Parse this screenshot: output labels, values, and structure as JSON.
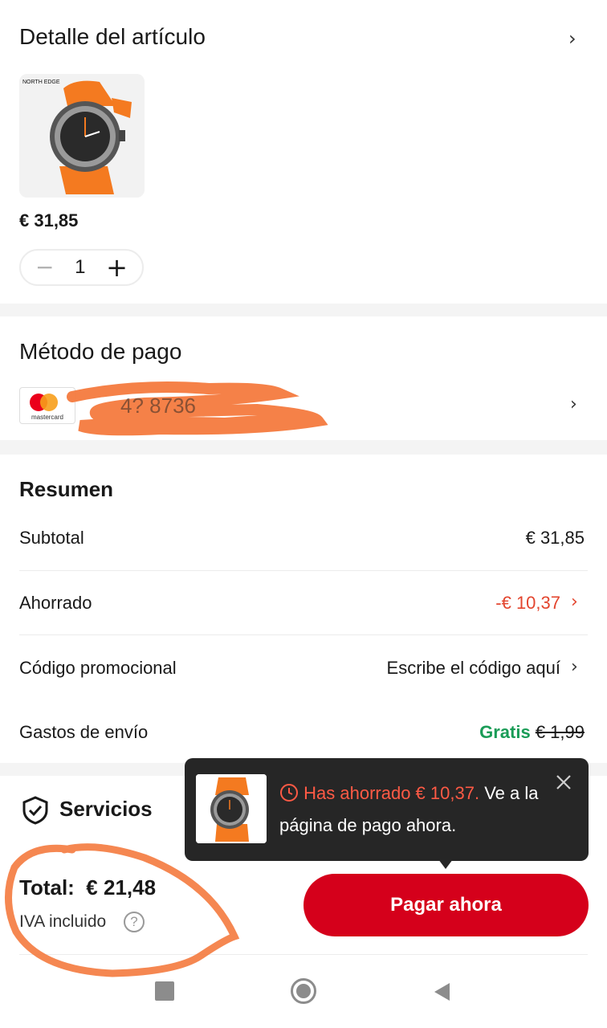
{
  "item_detail": {
    "title": "Detalle del artículo",
    "brand_text": "NORTH EDGE",
    "price": "€ 31,85",
    "quantity": "1",
    "minus_symbol": "−",
    "plus_symbol": "+"
  },
  "payment": {
    "title": "Método de pago",
    "card_brand": "mastercard"
  },
  "summary": {
    "title": "Resumen",
    "rows": [
      {
        "label": "Subtotal",
        "value": "€ 31,85"
      },
      {
        "label": "Ahorrado",
        "value": "-€ 10,37"
      },
      {
        "label": "Código promocional",
        "value": "Escribe el código aquí"
      },
      {
        "label": "Gastos de envío",
        "value_free": "Gratis",
        "value_old": "€ 1,99"
      }
    ]
  },
  "services": {
    "title": "Servicios"
  },
  "bottom": {
    "total_label": "Total:",
    "total_value": "€ 21,48",
    "vat_note": "IVA incluido",
    "help_symbol": "?",
    "pay_button": "Pagar ahora"
  },
  "tooltip": {
    "highlight": "Has ahorrado € 10,37.",
    "text": "Ve a la página de pago ahora."
  },
  "colors": {
    "primary_red": "#d5001b",
    "saved_red": "#e3452e",
    "free_green": "#1a9c57",
    "tooltip_bg": "#262626"
  },
  "icons": [
    "chevron-right-icon",
    "mastercard-logo",
    "shield-check-icon",
    "help-circle-icon",
    "clock-icon",
    "close-icon",
    "nav-recents-icon",
    "nav-home-icon",
    "nav-back-icon"
  ]
}
